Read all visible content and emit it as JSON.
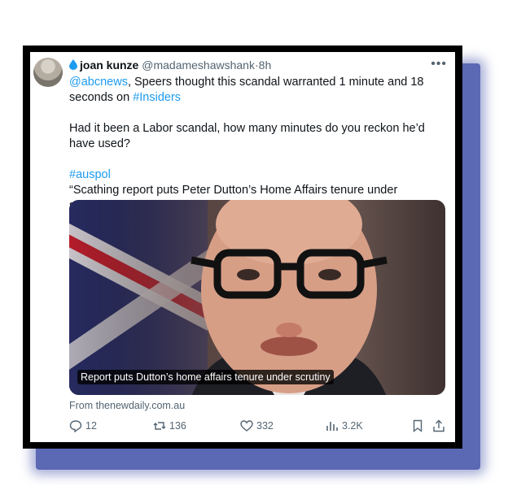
{
  "tweet": {
    "author_name": "joan kunze",
    "handle": "@madameshawshank",
    "separator": "·",
    "time": "8h",
    "more_label": "•••",
    "mention": "@abcnews",
    "line1_mid": ", Speers thought this scandal warranted 1 minute and 18 seconds on ",
    "hashtag1": "#Insiders",
    "paragraph2": "Had it been a Labor scandal, how many minutes do you reckon he’d have used?",
    "hashtag2": "#auspol",
    "quote": "“Scathing report puts Peter Dutton’s Home Affairs tenure under scrutiny”",
    "media_caption": "Report puts Dutton’s home affairs tenure under scrutiny",
    "source": "From thenewdaily.com.au",
    "replies": "12",
    "reposts": "136",
    "likes": "332",
    "views": "3.2K"
  },
  "colors": {
    "link": "#1d9bf0",
    "muted": "#536471",
    "shadow": "#5b68b4",
    "frame": "#000000"
  },
  "icons": [
    "water-drop-icon",
    "more-icon",
    "reply-icon",
    "repost-icon",
    "like-icon",
    "views-icon",
    "bookmark-icon",
    "share-icon"
  ]
}
